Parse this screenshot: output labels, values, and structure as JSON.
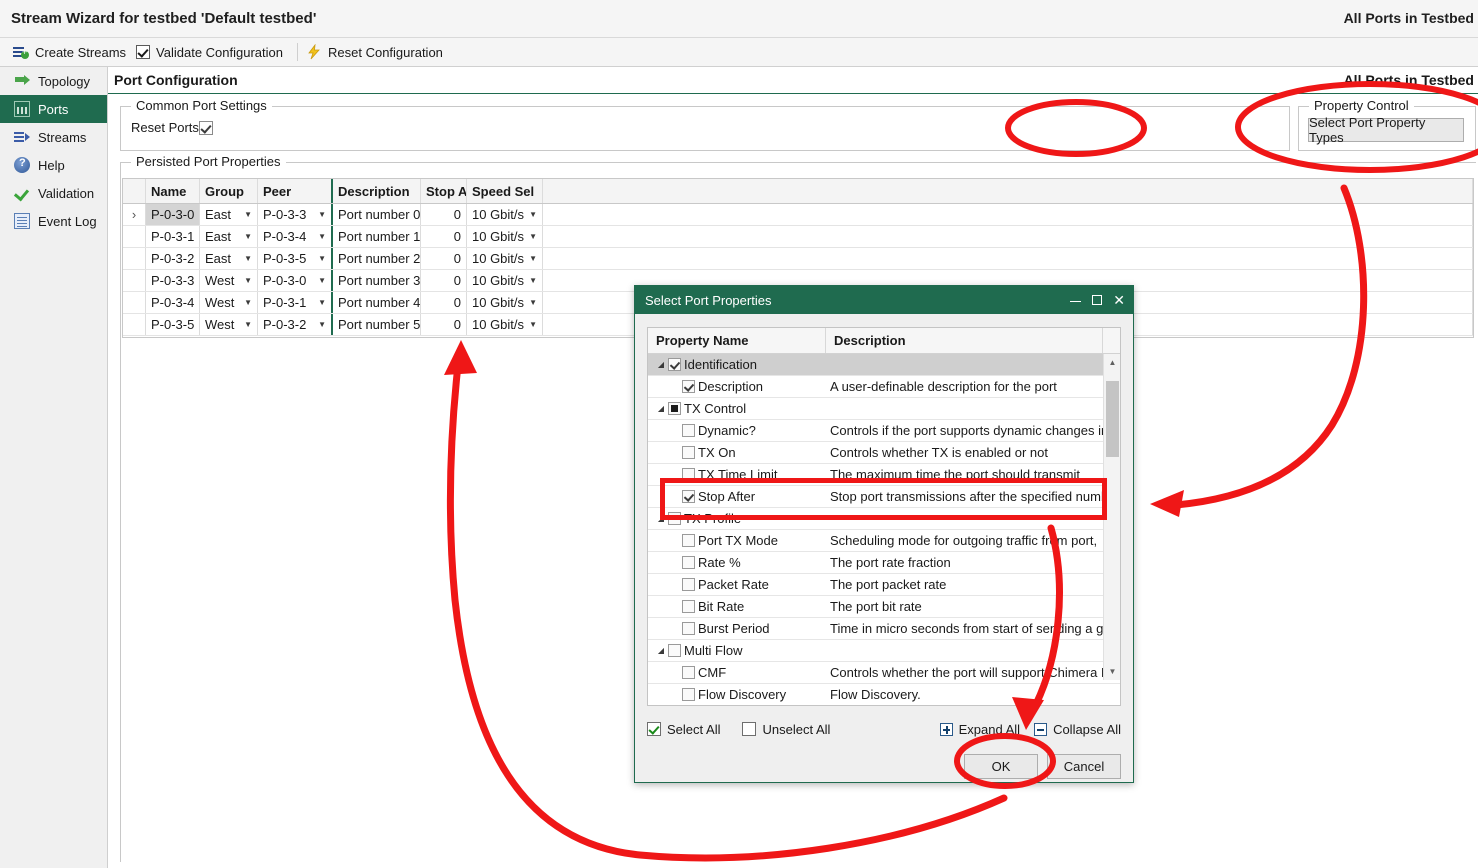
{
  "titlebar": {
    "app_title": "Stream Wizard for testbed 'Default testbed'",
    "right_title": "All Ports in Testbed"
  },
  "toolbar": {
    "items": [
      {
        "label": "Create Streams",
        "icon": "create-streams-icon"
      },
      {
        "label": "Validate Configuration",
        "icon": "checkbox-checked-icon"
      },
      {
        "label": "Reset Configuration",
        "icon": "lightning-bolt-icon"
      }
    ]
  },
  "sidebar": {
    "items": [
      {
        "label": "Topology",
        "icon": "green-arrow-icon",
        "active": false
      },
      {
        "label": "Ports",
        "icon": "ports-bars-icon",
        "active": true
      },
      {
        "label": "Streams",
        "icon": "streams-arrow-icon",
        "active": false
      },
      {
        "label": "Help",
        "icon": "question-mark-icon",
        "active": false
      },
      {
        "label": "Validation",
        "icon": "green-check-icon",
        "active": false
      },
      {
        "label": "Event Log",
        "icon": "log-grid-icon",
        "active": false
      }
    ]
  },
  "content": {
    "header_title": "Port Configuration",
    "header_right": "All Ports in Testbed",
    "common_port_settings": {
      "legend": "Common Port Settings",
      "reset_ports_label": "Reset Ports:",
      "reset_ports_checked": true
    },
    "property_control": {
      "legend": "Property Control",
      "button_label": "Select Port Property Types"
    },
    "persisted_port_properties": {
      "legend": "Persisted Port Properties",
      "columns": [
        "",
        "Name",
        "Group",
        "Peer",
        "Description",
        "Stop Af",
        "Speed Sel"
      ],
      "rows": [
        {
          "expander": "›",
          "name": "P-0-3-0",
          "group": "East",
          "peer": "P-0-3-3",
          "description": "Port number 0",
          "stop_after": "0",
          "speed": "10 Gbit/s",
          "selected": true
        },
        {
          "expander": "",
          "name": "P-0-3-1",
          "group": "East",
          "peer": "P-0-3-4",
          "description": "Port number 1",
          "stop_after": "0",
          "speed": "10 Gbit/s",
          "selected": false
        },
        {
          "expander": "",
          "name": "P-0-3-2",
          "group": "East",
          "peer": "P-0-3-5",
          "description": "Port number 2",
          "stop_after": "0",
          "speed": "10 Gbit/s",
          "selected": false
        },
        {
          "expander": "",
          "name": "P-0-3-3",
          "group": "West",
          "peer": "P-0-3-0",
          "description": "Port number 3",
          "stop_after": "0",
          "speed": "10 Gbit/s",
          "selected": false
        },
        {
          "expander": "",
          "name": "P-0-3-4",
          "group": "West",
          "peer": "P-0-3-1",
          "description": "Port number 4",
          "stop_after": "0",
          "speed": "10 Gbit/s",
          "selected": false
        },
        {
          "expander": "",
          "name": "P-0-3-5",
          "group": "West",
          "peer": "P-0-3-2",
          "description": "Port number 5",
          "stop_after": "0",
          "speed": "10 Gbit/s",
          "selected": false
        }
      ]
    }
  },
  "dialog": {
    "title": "Select Port Properties",
    "window_buttons": {
      "minimize": "minimize-icon",
      "maximize": "maximize-icon",
      "close": "✕"
    },
    "columns": {
      "name": "Property Name",
      "description": "Description"
    },
    "rows": [
      {
        "name": "Identification",
        "description": "",
        "level": "group",
        "check": "on",
        "highlighted": true
      },
      {
        "name": "Description",
        "description": "A user-definable description for the port",
        "level": "child",
        "check": "on",
        "highlighted": false
      },
      {
        "name": "TX Control",
        "description": "",
        "level": "group",
        "check": "partial",
        "highlighted": false
      },
      {
        "name": "Dynamic?",
        "description": "Controls if the port supports dynamic changes ir",
        "level": "child",
        "check": "none",
        "highlighted": false
      },
      {
        "name": "TX On",
        "description": "Controls whether TX is enabled or not",
        "level": "child",
        "check": "none",
        "highlighted": false
      },
      {
        "name": "TX Time Limit",
        "description": "The maximum time the port should transmit",
        "level": "child",
        "check": "none",
        "highlighted": false
      },
      {
        "name": "Stop After",
        "description": "Stop port transmissions after the specified numb",
        "level": "child",
        "check": "on",
        "highlighted": false
      },
      {
        "name": "TX Profile",
        "description": "",
        "level": "group",
        "check": "none",
        "highlighted": false
      },
      {
        "name": "Port TX Mode",
        "description": "Scheduling mode for outgoing traffic from port,",
        "level": "child",
        "check": "none",
        "highlighted": false
      },
      {
        "name": "Rate %",
        "description": "The port rate fraction",
        "level": "child",
        "check": "none",
        "highlighted": false
      },
      {
        "name": "Packet Rate",
        "description": "The port packet rate",
        "level": "child",
        "check": "none",
        "highlighted": false
      },
      {
        "name": "Bit Rate",
        "description": "The port bit rate",
        "level": "child",
        "check": "none",
        "highlighted": false
      },
      {
        "name": "Burst Period",
        "description": "Time in micro seconds from start of sending a gr",
        "level": "child",
        "check": "none",
        "highlighted": false
      },
      {
        "name": "Multi Flow",
        "description": "",
        "level": "group",
        "check": "none",
        "highlighted": false
      },
      {
        "name": "CMF",
        "description": "Controls whether the port will support Chimera M",
        "level": "child",
        "check": "none",
        "highlighted": false
      },
      {
        "name": "Flow Discovery",
        "description": "Flow Discovery.",
        "level": "child",
        "check": "none",
        "highlighted": false
      }
    ],
    "footer": {
      "select_all": "Select All",
      "select_all_checked": true,
      "unselect_all": "Unselect All",
      "unselect_all_checked": false,
      "expand_all": "Expand All",
      "collapse_all": "Collapse All"
    },
    "actions": {
      "ok": "OK",
      "cancel": "Cancel"
    }
  },
  "annotations": {
    "color": "#ef1717",
    "shapes": [
      {
        "type": "ellipse",
        "name": "highlight-property-control"
      },
      {
        "type": "ellipse",
        "name": "highlight-reset-area"
      },
      {
        "type": "rectangle",
        "name": "highlight-stop-after-row"
      },
      {
        "type": "ellipse",
        "name": "highlight-ok-button"
      },
      {
        "type": "arrow",
        "name": "arrow-property-control-to-stop-after"
      },
      {
        "type": "arrow",
        "name": "arrow-stop-after-to-ok"
      },
      {
        "type": "arrow",
        "name": "arrow-ok-to-port-grid"
      }
    ]
  }
}
